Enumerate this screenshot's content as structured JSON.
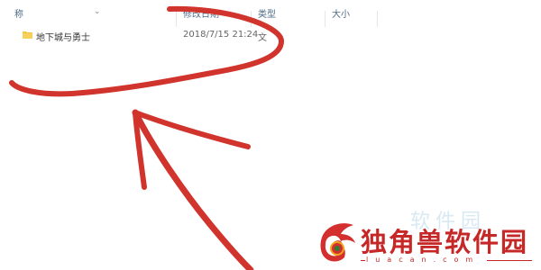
{
  "columns": {
    "name": "称",
    "date": "修改日期",
    "type": "类型",
    "size": "大小"
  },
  "files": [
    {
      "name": "地下城与勇士",
      "date": "2018/7/15 21:24",
      "type": "文",
      "icon": "folder-icon"
    }
  ],
  "watermark": {
    "title": "独角兽软件园",
    "url": "luacan.com",
    "faint": "软件园"
  },
  "colors": {
    "annotation": "#d0342c",
    "folder": "#f4c542",
    "watermark": "#c62828"
  }
}
